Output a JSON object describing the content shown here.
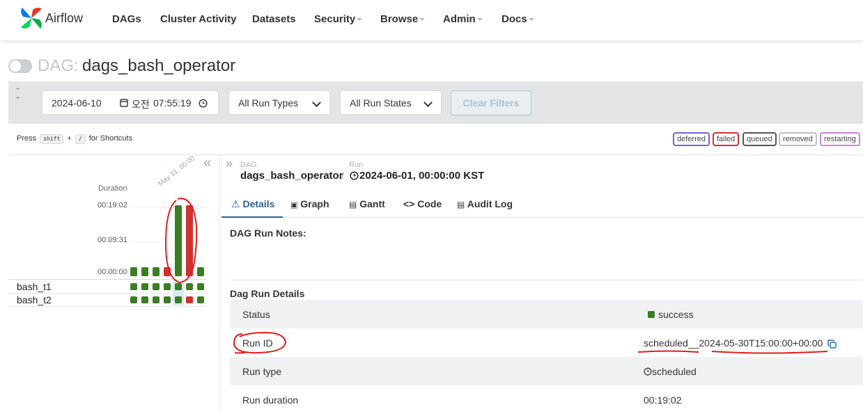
{
  "nav": {
    "brand": "Airflow",
    "items": [
      "DAGs",
      "Cluster Activity",
      "Datasets",
      "Security",
      "Browse",
      "Admin",
      "Docs"
    ]
  },
  "dag": {
    "prefix": "DAG:",
    "name": "dags_bash_operator"
  },
  "filters": {
    "date": "2024-06-10",
    "ampm": "오전",
    "time": "07:55:19",
    "run_types": "All Run Types",
    "run_states": "All Run States",
    "clear": "Clear Filters"
  },
  "shortcut": {
    "press": "Press",
    "key1": "shift",
    "plus": "+",
    "key2": "/",
    "suffix": "for Shortcuts"
  },
  "legend": [
    {
      "label": "deferred",
      "color": "#7b61c8"
    },
    {
      "label": "failed",
      "color": "#d0312d"
    },
    {
      "label": "queued",
      "color": "#777777"
    },
    {
      "label": "removed",
      "color": "#bfbfbf"
    },
    {
      "label": "restarting",
      "color": "#c985e0"
    }
  ],
  "grid": {
    "duration_label": "Duration",
    "ticks": [
      "00:19:02",
      "00:09:31",
      "00:00:00"
    ],
    "date_label": "May 31, 00:00",
    "colors": {
      "success": "#3a7d23",
      "failed": "#d0312d"
    },
    "run_durations_seconds": [
      20,
      20,
      20,
      20,
      1142,
      1142,
      20
    ],
    "run_states": [
      "success",
      "success",
      "success",
      "failed",
      "success",
      "failed",
      "success"
    ],
    "tasks": [
      {
        "name": "bash_t1",
        "states": [
          "success",
          "success",
          "success",
          "success",
          "success",
          "success",
          "success"
        ]
      },
      {
        "name": "bash_t2",
        "states": [
          "success",
          "success",
          "success",
          "success",
          "success",
          "failed",
          "success"
        ]
      }
    ]
  },
  "detail": {
    "crumb_dag_label": "DAG",
    "crumb_dag_value": "dags_bash_operator",
    "crumb_sep": "/",
    "crumb_run_label": "Run",
    "crumb_run_value": "2024-06-01, 00:00:00 KST",
    "tabs": [
      "Details",
      "Graph",
      "Gantt",
      "Code",
      "Audit Log"
    ],
    "notes_title": "DAG Run Notes:",
    "details_title": "Dag Run Details",
    "rows": [
      {
        "key": "Status",
        "value": "success"
      },
      {
        "key": "Run ID",
        "value": "scheduled__2024-05-30T15:00:00+00:00"
      },
      {
        "key": "Run type",
        "value": "scheduled"
      },
      {
        "key": "Run duration",
        "value": "00:19:02"
      }
    ]
  }
}
